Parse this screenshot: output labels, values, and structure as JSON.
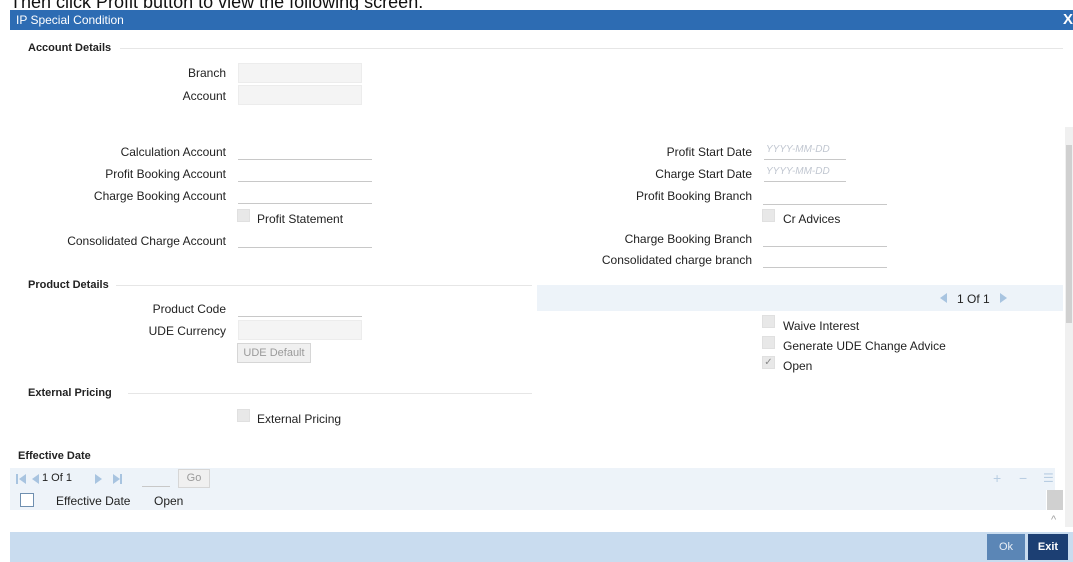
{
  "caption": "Then click Profit button to view the following screen.",
  "window": {
    "title": "IP Special Condition",
    "close_glyph": "X"
  },
  "account_details": {
    "section_title": "Account Details",
    "branch_label": "Branch",
    "branch_value": "",
    "account_label": "Account",
    "account_value": ""
  },
  "calc": {
    "calculation_account_label": "Calculation Account",
    "profit_booking_account_label": "Profit Booking Account",
    "charge_booking_account_label": "Charge Booking Account",
    "profit_statement_label": "Profit Statement",
    "consolidated_charge_account_label": "Consolidated Charge Account",
    "profit_start_date_label": "Profit Start Date",
    "profit_start_date_placeholder": "YYYY-MM-DD",
    "charge_start_date_label": "Charge Start Date",
    "charge_start_date_placeholder": "YYYY-MM-DD",
    "profit_booking_branch_label": "Profit Booking Branch",
    "cr_advices_label": "Cr Advices",
    "charge_booking_branch_label": "Charge Booking Branch",
    "consolidated_charge_branch_label": "Consolidated charge branch"
  },
  "product_details": {
    "section_title": "Product Details",
    "product_code_label": "Product Code",
    "ude_currency_label": "UDE Currency",
    "ude_default_button": "UDE Default",
    "pager_text": "1 Of 1",
    "waive_interest_label": "Waive Interest",
    "generate_ude_label": "Generate UDE Change Advice",
    "open_label": "Open",
    "open_checked": true
  },
  "external_pricing": {
    "section_title": "External Pricing",
    "checkbox_label": "External Pricing"
  },
  "effective_date": {
    "section_title": "Effective Date",
    "pager_text": "1 Of 1",
    "go_button": "Go",
    "columns": [
      "Effective Date",
      "Open"
    ]
  },
  "footer": {
    "ok_label": "Ok",
    "exit_label": "Exit"
  }
}
